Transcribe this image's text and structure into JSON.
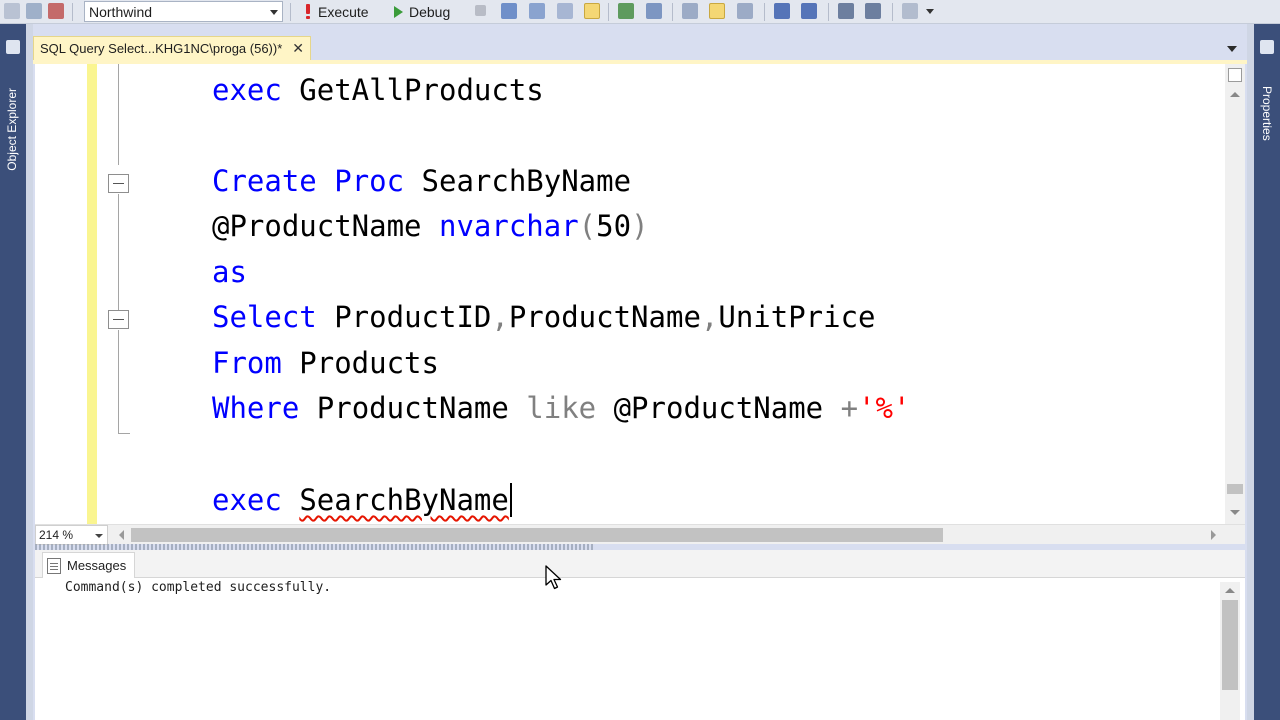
{
  "toolbar": {
    "database": "Northwind",
    "execute_label": "Execute",
    "debug_label": "Debug"
  },
  "docks": {
    "left_label": "Object Explorer",
    "right_label": "Properties"
  },
  "tab": {
    "title": "SQL Query Select...KHG1NC\\proga (56))*",
    "close": "✕"
  },
  "editor": {
    "lines": {
      "l1": {
        "a": "exec",
        "b": " GetAllProducts"
      },
      "l2": {
        "a": "Create",
        "b": " ",
        "c": "Proc",
        "d": " SearchByName"
      },
      "l3": {
        "a": "@ProductName ",
        "b": "nvarchar",
        "c": "(",
        "d": "50",
        "e": ")"
      },
      "l4": {
        "a": "as"
      },
      "l5": {
        "a": "Select",
        "b": " ProductID",
        "c": ",",
        "d": "ProductName",
        "e": ",",
        "f": "UnitPrice"
      },
      "l6": {
        "a": "From",
        "b": " Products"
      },
      "l7": {
        "a": "Where",
        "b": " ProductName ",
        "c": "like",
        "d": " @ProductName ",
        "e": "+",
        "f": "'%'"
      },
      "l8": {
        "a": "exec",
        "b": " ",
        "c": "SearchByName"
      }
    },
    "zoom": "214 %"
  },
  "results": {
    "tab_label": "Messages",
    "message": "Command(s) completed successfully."
  },
  "colors": {
    "keyword": "#0000ff",
    "gray_operator": "#808080",
    "string": "#ff0000",
    "tab_active": "#fff5c6",
    "dock": "#3b4f7a"
  }
}
